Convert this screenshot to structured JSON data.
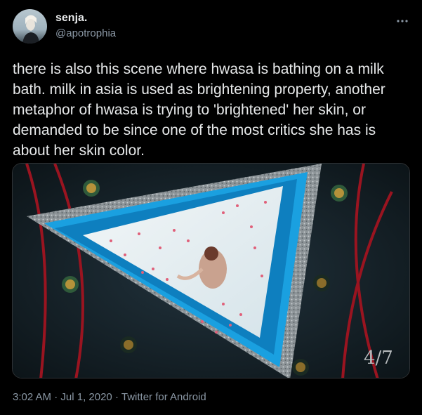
{
  "user": {
    "display_name": "senja.",
    "handle": "@apotrophia",
    "avatar_icon": "user-avatar"
  },
  "menu_icon": "more-options-icon",
  "tweet_text": "there is also this scene where hwasa is bathing on a milk bath. milk in asia is used as brightening property, another metaphor of hwasa is trying to 'brightened' her skin, or demanded to be since one of the most critics she has is about her skin color.",
  "media": {
    "watermark": "4/7"
  },
  "meta": {
    "time": "3:02 AM",
    "separator": "·",
    "date": "Jul 1, 2020",
    "source": "Twitter for Android"
  },
  "colors": {
    "background": "#000000",
    "text_primary": "#e7e9ea",
    "text_secondary": "#8b98a5",
    "pool_blue": "#1aa0e0",
    "milk": "#eaf0f2",
    "rope_red": "#9a1420"
  }
}
